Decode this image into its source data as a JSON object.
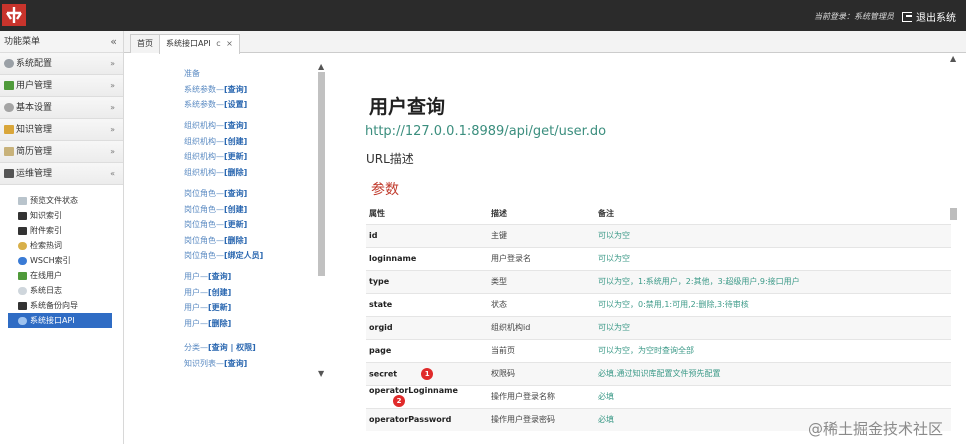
{
  "header": {
    "logged_in_label": "当前登录：系统管理员",
    "logout_label": "退出系统"
  },
  "sidebar": {
    "title": "功能菜单",
    "collapse_glyph": "«",
    "groups": [
      {
        "label": "系统配置",
        "chev": "»"
      },
      {
        "label": "用户管理",
        "chev": "»"
      },
      {
        "label": "基本设置",
        "chev": "»"
      },
      {
        "label": "知识管理",
        "chev": "»"
      },
      {
        "label": "简历管理",
        "chev": "»"
      },
      {
        "label": "运维管理",
        "chev": "«"
      }
    ],
    "subitems": [
      "预览文件状态",
      "知识索引",
      "附件索引",
      "检索热词",
      "WSCH索引",
      "在线用户",
      "系统日志",
      "系统备份向导",
      "系统接口API"
    ]
  },
  "tabs": [
    {
      "label": "首页"
    },
    {
      "label": "系统接口API",
      "refresh": "c",
      "close": "×"
    }
  ],
  "apilist": {
    "groups": [
      [
        {
          "prefix": "准备",
          "action": ""
        },
        {
          "prefix": "系统参数—",
          "action": "[查询]"
        },
        {
          "prefix": "系统参数—",
          "action": "[设置]"
        }
      ],
      [
        {
          "prefix": "组织机构—",
          "action": "[查询]"
        },
        {
          "prefix": "组织机构—",
          "action": "[创建]"
        },
        {
          "prefix": "组织机构—",
          "action": "[更新]"
        },
        {
          "prefix": "组织机构—",
          "action": "[删除]"
        }
      ],
      [
        {
          "prefix": "岗位角色—",
          "action": "[查询]"
        },
        {
          "prefix": "岗位角色—",
          "action": "[创建]"
        },
        {
          "prefix": "岗位角色—",
          "action": "[更新]"
        },
        {
          "prefix": "岗位角色—",
          "action": "[删除]"
        },
        {
          "prefix": "岗位角色—",
          "action": "[绑定人员]"
        }
      ],
      [
        {
          "prefix": "用户—",
          "action": "[查询]"
        },
        {
          "prefix": "用户—",
          "action": "[创建]"
        },
        {
          "prefix": "用户—",
          "action": "[更新]"
        },
        {
          "prefix": "用户—",
          "action": "[删除]"
        }
      ],
      [
        {
          "prefix": "分类—",
          "action": "[查询 | 权限]"
        },
        {
          "prefix": "知识列表—",
          "action": "[查询]"
        }
      ]
    ]
  },
  "detail": {
    "title": "用户查询",
    "url": "http://127.0.0.1:8989/api/get/user.do",
    "url_desc": "URL描述",
    "params_title": "参数",
    "columns": [
      "属性",
      "描述",
      "备注"
    ],
    "rows": [
      {
        "name": "id",
        "desc": "主键",
        "note": "可以为空",
        "badge": ""
      },
      {
        "name": "loginname",
        "desc": "用户登录名",
        "note": "可以为空",
        "badge": ""
      },
      {
        "name": "type",
        "desc": "类型",
        "note": "可以为空，1:系统用户，2:其他，3:超级用户,9:接口用户",
        "badge": ""
      },
      {
        "name": "state",
        "desc": "状态",
        "note": "可以为空，0:禁用,1:可用,2:删除,3:待审核",
        "badge": ""
      },
      {
        "name": "orgid",
        "desc": "组织机构id",
        "note": "可以为空",
        "badge": ""
      },
      {
        "name": "page",
        "desc": "当前页",
        "note": "可以为空，为空时查询全部",
        "badge": ""
      },
      {
        "name": "secret",
        "desc": "权限码",
        "note": "必填,通过知识库配置文件预先配置",
        "badge": "1"
      },
      {
        "name": "operatorLoginname",
        "desc": "操作用户登录名称",
        "note": "必填",
        "badge": "2"
      },
      {
        "name": "operatorPassword",
        "desc": "操作用户登录密码",
        "note": "必填",
        "badge": ""
      }
    ]
  },
  "watermark": "@稀土掘金技术社区",
  "colors": {
    "accent": "#2f6cc4",
    "link": "#5a8ac2",
    "note": "#3c9a88",
    "param_title": "#c0392b",
    "badge": "#e02a2a"
  }
}
